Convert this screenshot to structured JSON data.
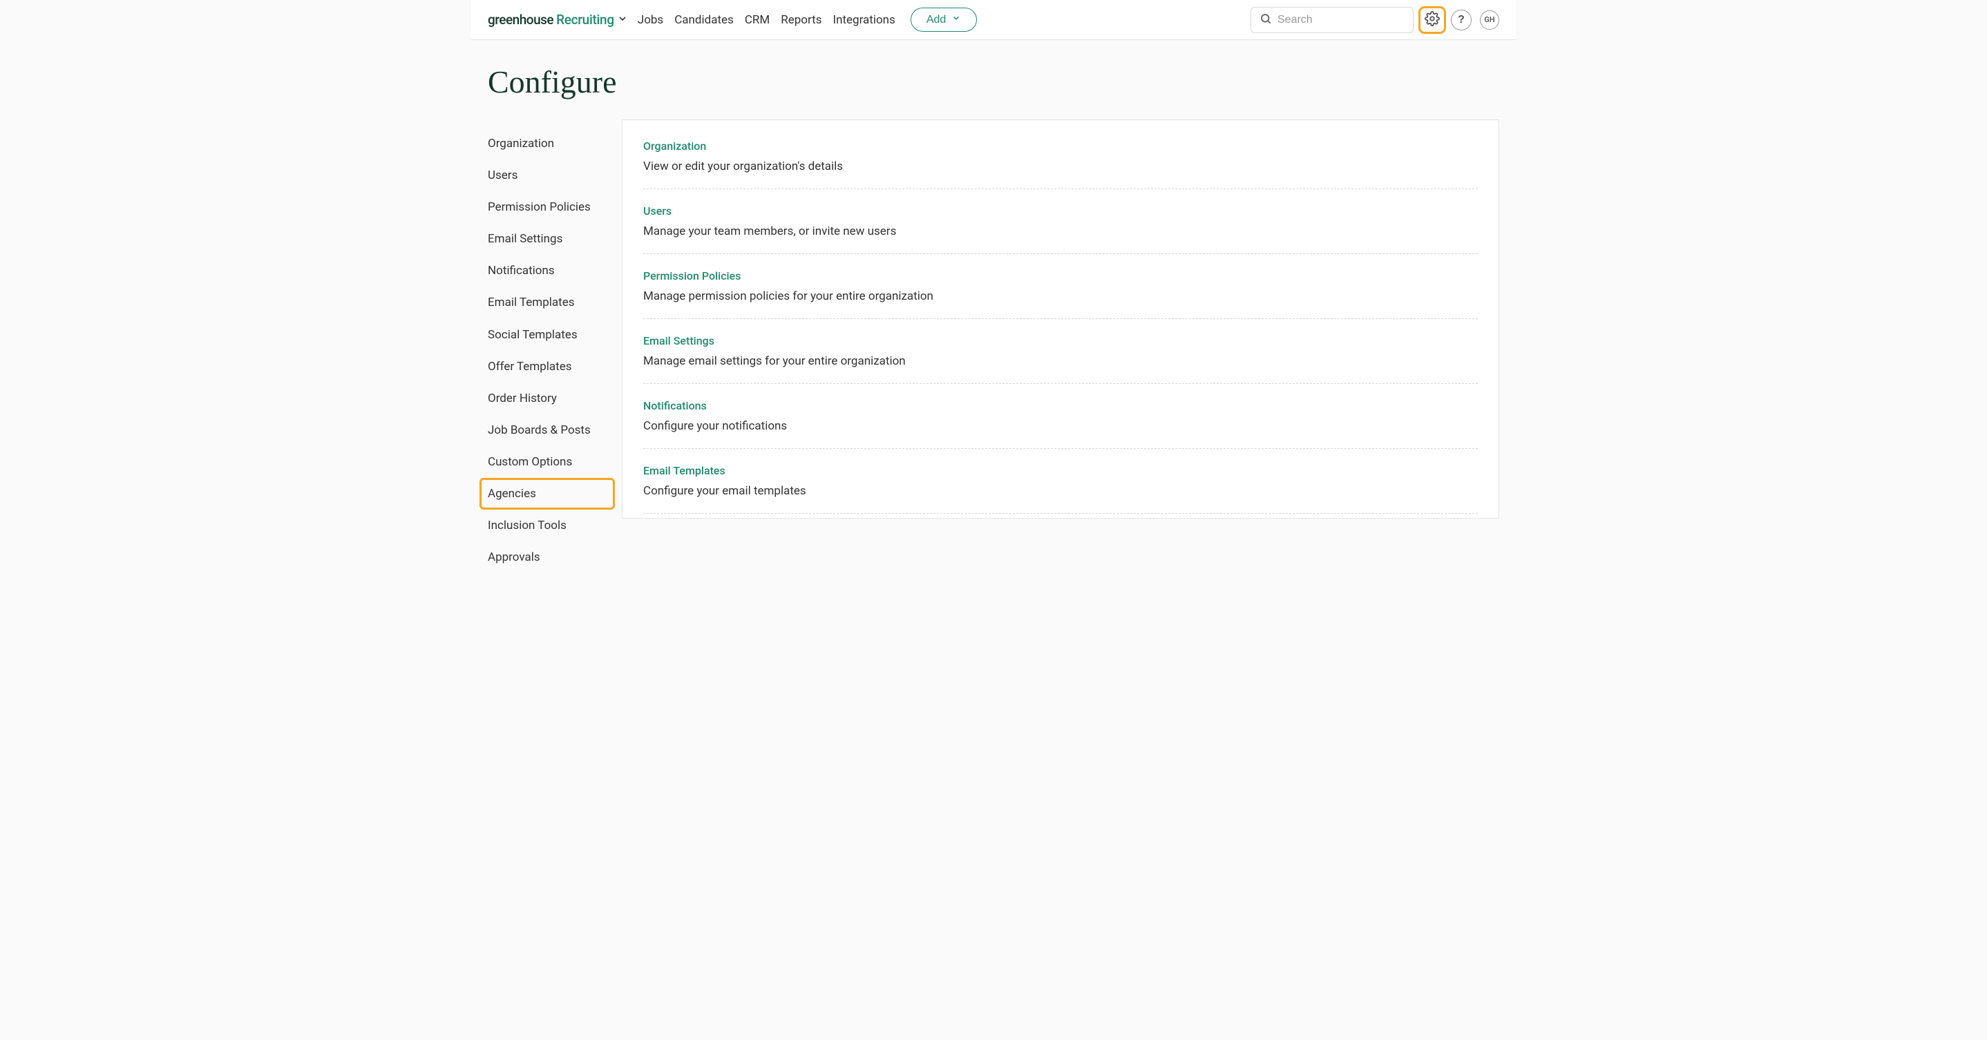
{
  "brand": {
    "word1": "greenhouse",
    "word2": "Recruiting"
  },
  "nav": {
    "jobs": "Jobs",
    "candidates": "Candidates",
    "crm": "CRM",
    "reports": "Reports",
    "integrations": "Integrations",
    "add": "Add"
  },
  "search": {
    "placeholder": "Search"
  },
  "avatar": {
    "initials": "GH"
  },
  "page": {
    "title": "Configure"
  },
  "sidebar": {
    "items": [
      {
        "label": "Organization"
      },
      {
        "label": "Users"
      },
      {
        "label": "Permission Policies"
      },
      {
        "label": "Email Settings"
      },
      {
        "label": "Notifications"
      },
      {
        "label": "Email Templates"
      },
      {
        "label": "Social Templates"
      },
      {
        "label": "Offer Templates"
      },
      {
        "label": "Order History"
      },
      {
        "label": "Job Boards & Posts"
      },
      {
        "label": "Custom Options"
      },
      {
        "label": "Agencies"
      },
      {
        "label": "Inclusion Tools"
      },
      {
        "label": "Approvals"
      }
    ]
  },
  "sections": [
    {
      "title": "Organization",
      "desc": "View or edit your organization's details"
    },
    {
      "title": "Users",
      "desc": "Manage your team members, or invite new users"
    },
    {
      "title": "Permission Policies",
      "desc": "Manage permission policies for your entire organization"
    },
    {
      "title": "Email Settings",
      "desc": "Manage email settings for your entire organization"
    },
    {
      "title": "Notifications",
      "desc": "Configure your notifications"
    },
    {
      "title": "Email Templates",
      "desc": "Configure your email templates"
    }
  ]
}
